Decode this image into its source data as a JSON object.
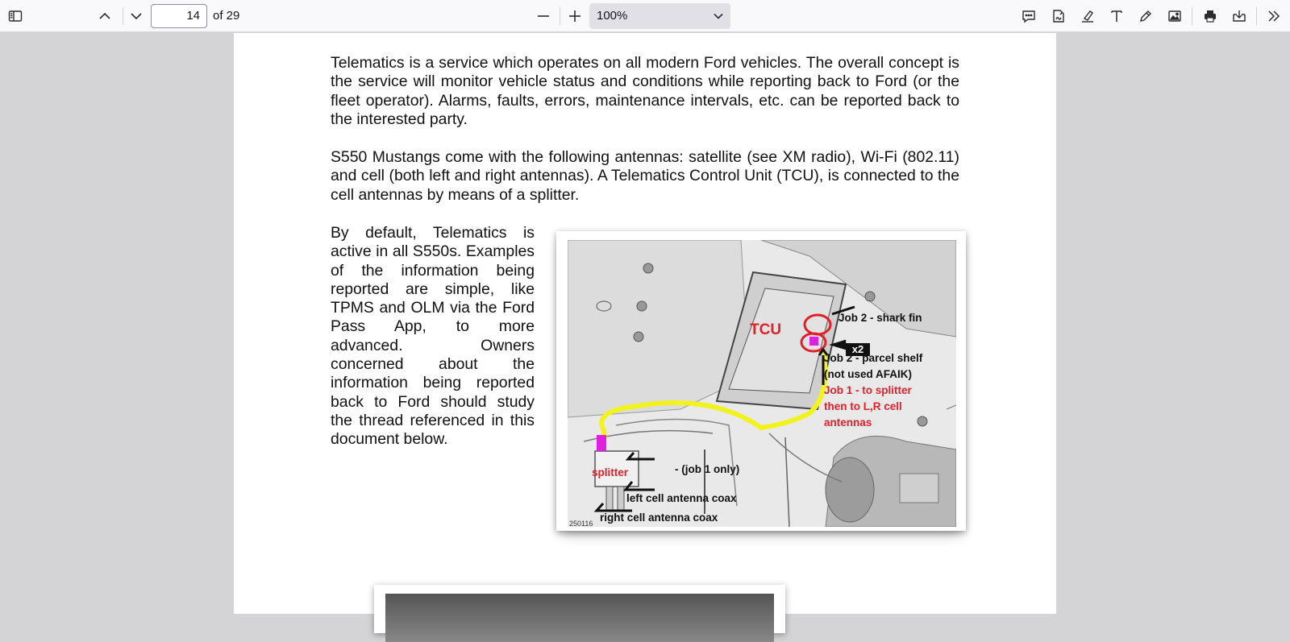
{
  "toolbar": {
    "page_number": "14",
    "page_count": "of 29",
    "zoom": "100%",
    "icons": {
      "sidebar": "sidebar-toggle-icon",
      "prev": "chevron-up-icon",
      "next": "chevron-down-icon",
      "zoom_out": "minus-icon",
      "zoom_in": "plus-icon",
      "comment": "comment-icon",
      "signature": "signature-icon",
      "highlight": "highlight-icon",
      "text": "text-icon",
      "draw": "draw-icon",
      "image": "image-icon",
      "print": "print-icon",
      "save": "save-icon",
      "tools": "double-chevron-right-icon"
    }
  },
  "document": {
    "para1": "Telematics is a service which operates on all modern Ford vehicles. The overall concept is the service will monitor vehicle status and conditions while reporting back to Ford (or the fleet operator). Alarms, faults, errors, maintenance intervals, etc. can be reported back to the interested party.",
    "para2": "S550 Mustangs come with the following antennas: satellite (see XM radio), Wi-Fi (802.11) and cell (both left and right antennas). A Telematics Control Unit (TCU), is connected to the cell antennas by means of a splitter.",
    "para3": "By default, Telematics is active in all S550s. Examples of the information being reported are simple, like TPMS and OLM via the Ford Pass App, to more advanced. Owners concerned about the information being reported back to Ford should study the thread referenced in this document below.",
    "figure": {
      "tcu": "TCU",
      "job2_shark": "Job 2 - shark fin",
      "x2": "x2",
      "job2_parcel_1": "Job 2 - parcel shelf",
      "job2_parcel_2": "(not used AFAIK)",
      "job1_1": "Job 1 - to splitter",
      "job1_2": "then to L,R cell",
      "job1_3": "antennas",
      "splitter": "splitter",
      "job1_only": "- (job 1 only)",
      "left_coax": "left cell antenna coax",
      "right_coax": "right cell antenna coax",
      "fig_id": "250116"
    }
  },
  "colors": {
    "toolbar_bg": "#f9f9fb",
    "viewer_bg": "#d4d4d7",
    "annotation_red": "#e0202a",
    "cable_yellow": "#f2f21c",
    "splitter_magenta": "#e020e0"
  }
}
